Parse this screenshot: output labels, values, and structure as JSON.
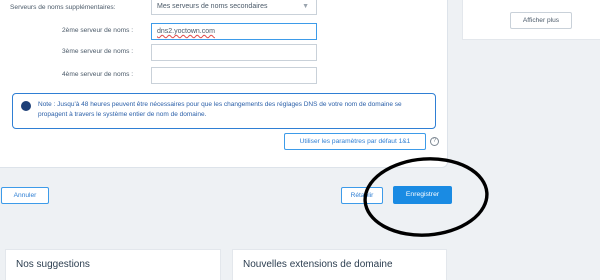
{
  "dns": {
    "extra_label": "Serveurs de noms supplémentaires:",
    "extra_select": "Mes serveurs de noms secondaires",
    "ns2_label": "2ème serveur de noms :",
    "ns2_value": "dns2.yoctown.com",
    "ns3_label": "3ème serveur de noms :",
    "ns3_value": "",
    "ns4_label": "4ème serveur de noms :",
    "ns4_value": ""
  },
  "note": {
    "text": "Note : Jusqu'à 48 heures peuvent être nécessaires pour que les changements des réglages DNS de votre nom de domaine se propagent à travers le système entier de nom de domaine."
  },
  "actions": {
    "default_label": "Utiliser les paramètres par défaut 1&1",
    "help": "?",
    "cancel_label": "Annuler",
    "reset_label": "Rétablir",
    "save_label": "Enregistrer"
  },
  "sidebar": {
    "more_label": "Afficher plus"
  },
  "cards": {
    "suggestions_title": "Nos suggestions",
    "extensions_title": "Nouvelles extensions de domaine"
  },
  "colors": {
    "primary": "#1a8be3",
    "note_border": "#2f7fd4",
    "annotation": "#000000"
  }
}
